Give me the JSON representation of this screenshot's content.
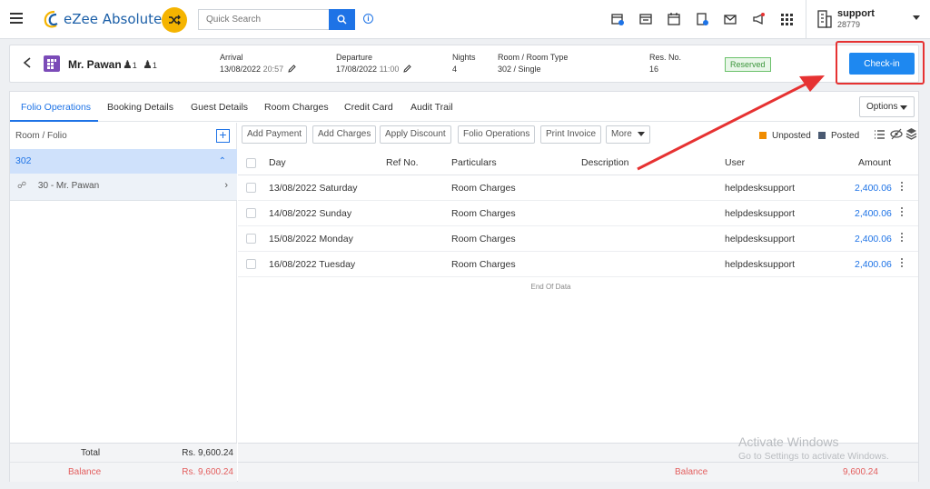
{
  "app": {
    "brand": "eZee Absolute",
    "search_placeholder": "Quick Search"
  },
  "user": {
    "name": "support",
    "id": "28779"
  },
  "guest": {
    "name": "Mr. Pawan",
    "adults": "1",
    "children": "1",
    "arrival_label": "Arrival",
    "arrival_date": "13/08/2022",
    "arrival_time": "20:57",
    "departure_label": "Departure",
    "departure_date": "17/08/2022",
    "departure_time": "11:00",
    "nights_label": "Nights",
    "nights": "4",
    "room_label": "Room / Room Type",
    "room": "302 / Single",
    "resno_label": "Res. No.",
    "resno": "16",
    "status": "Reserved",
    "checkin_label": "Check-in"
  },
  "tabs": [
    {
      "label": "Folio Operations"
    },
    {
      "label": "Booking Details"
    },
    {
      "label": "Guest Details"
    },
    {
      "label": "Room Charges"
    },
    {
      "label": "Credit Card"
    },
    {
      "label": "Audit Trail"
    }
  ],
  "options_label": "Options",
  "left": {
    "header": "Room / Folio",
    "room": "302",
    "folio": "30 - Mr. Pawan",
    "total_label": "Total",
    "total_value": "Rs. 9,600.24",
    "balance_label": "Balance",
    "balance_value": "Rs. 9,600.24"
  },
  "toolbar": {
    "add_payment": "Add Payment",
    "add_charges": "Add Charges",
    "apply_discount": "Apply Discount",
    "folio_operations": "Folio Operations",
    "print_invoice": "Print Invoice",
    "more": "More",
    "unposted": "Unposted",
    "posted": "Posted",
    "unposted_color": "#f08c00",
    "posted_color": "#4a5a72"
  },
  "table": {
    "headers": {
      "day": "Day",
      "ref": "Ref No.",
      "particulars": "Particulars",
      "description": "Description",
      "user": "User",
      "amount": "Amount"
    },
    "rows": [
      {
        "day": "13/08/2022 Saturday",
        "ref": "",
        "particulars": "Room Charges",
        "description": "",
        "user": "helpdesksupport",
        "amount": "2,400.06"
      },
      {
        "day": "14/08/2022 Sunday",
        "ref": "",
        "particulars": "Room Charges",
        "description": "",
        "user": "helpdesksupport",
        "amount": "2,400.06"
      },
      {
        "day": "15/08/2022 Monday",
        "ref": "",
        "particulars": "Room Charges",
        "description": "",
        "user": "helpdesksupport",
        "amount": "2,400.06"
      },
      {
        "day": "16/08/2022 Tuesday",
        "ref": "",
        "particulars": "Room Charges",
        "description": "",
        "user": "helpdesksupport",
        "amount": "2,400.06"
      }
    ],
    "end_text": "End Of Data",
    "balance_label": "Balance",
    "balance_value": "9,600.24"
  },
  "watermark": {
    "line1": "Activate Windows",
    "line2": "Go to Settings to activate Windows."
  },
  "colors": {
    "accent": "#1e73e6",
    "highlight": "#e63232",
    "reserved": "#3c963c"
  }
}
